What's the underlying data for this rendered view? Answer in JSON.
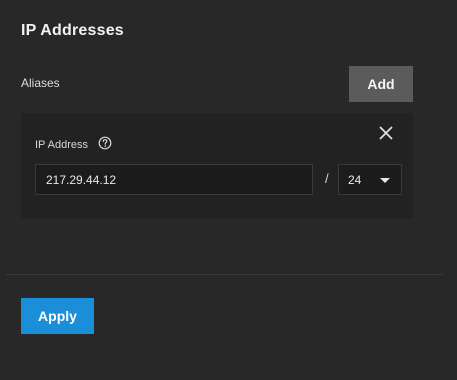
{
  "section": {
    "title": "IP Addresses"
  },
  "aliases": {
    "label": "Aliases",
    "add_label": "Add"
  },
  "alias_card": {
    "ip_label": "IP Address",
    "ip_value": "217.29.44.12",
    "separator": "/",
    "netmask_value": "24",
    "icons": {
      "close": "close-icon",
      "help": "help-circle-icon",
      "dropdown": "caret-down-icon"
    }
  },
  "footer": {
    "apply_label": "Apply"
  },
  "colors": {
    "background": "#282828",
    "card_background": "#222222",
    "add_button": "#5b5b5b",
    "apply_button": "#1a8ed6"
  }
}
